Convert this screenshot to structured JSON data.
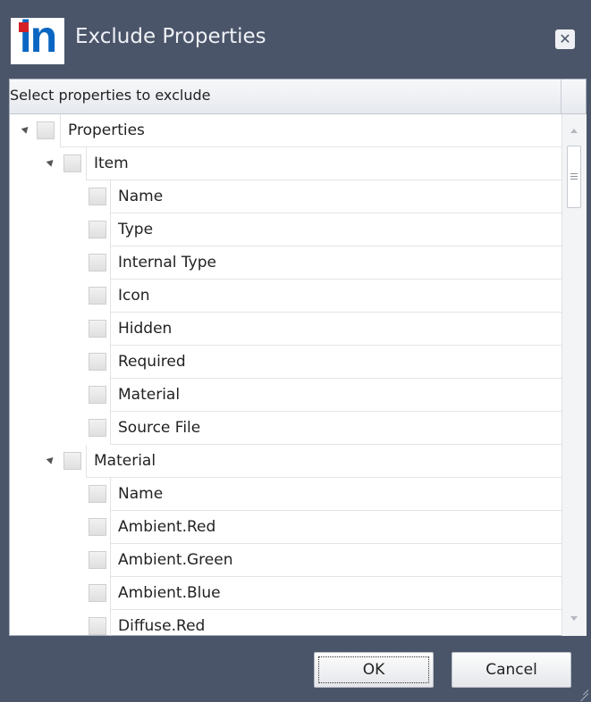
{
  "window": {
    "title": "Exclude Properties",
    "logo_text": "in",
    "close_label": "✕"
  },
  "colors": {
    "titlebar": "#4b5569",
    "logo_blue": "#0a66c2",
    "logo_red": "#d41f26"
  },
  "panel": {
    "header": "Select properties to exclude"
  },
  "tree": {
    "root": "Properties",
    "groups": [
      {
        "label": "Item",
        "items": [
          "Name",
          "Type",
          "Internal Type",
          "Icon",
          "Hidden",
          "Required",
          "Material",
          "Source File"
        ]
      },
      {
        "label": "Material",
        "items": [
          "Name",
          "Ambient.Red",
          "Ambient.Green",
          "Ambient.Blue",
          "Diffuse.Red"
        ]
      }
    ]
  },
  "buttons": {
    "ok": "OK",
    "cancel": "Cancel"
  }
}
